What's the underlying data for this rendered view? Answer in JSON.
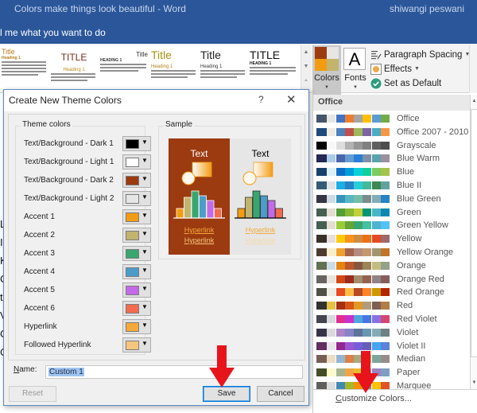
{
  "window": {
    "title": "Colors make things look beautiful  -  Word",
    "user": "shiwangi peswani",
    "tell_me": "l me what you want to do"
  },
  "ribbon": {
    "gallery_styles": [
      {
        "title": "Title",
        "heading": "Heading 1",
        "title_color": "#b57d1b",
        "heading_color": "#b57d1b"
      },
      {
        "title": "TITLE",
        "heading": "Heading 1",
        "title_color": "#7b2b1a",
        "heading_color": "#b58c1b"
      },
      {
        "title": "Title",
        "heading": "HEADING 1",
        "title_color": "#333333",
        "heading_color": "#333333"
      },
      {
        "title": "Title",
        "heading": "Heading 1",
        "title_color": "#a89218",
        "heading_color": "#b3801b"
      },
      {
        "title": "Title",
        "heading": "Heading 1",
        "title_color": "#222222",
        "heading_color": "#333333"
      },
      {
        "title": "TITLE",
        "heading": "HEADING 1",
        "title_color": "#111111",
        "heading_color": "#111111"
      }
    ],
    "colors_label": "Colors",
    "colors_swatch": [
      "#9c3a10",
      "#e6e6e6",
      "#f39c12",
      "#c2b46e"
    ],
    "fonts_label": "Fonts",
    "fonts_glyph": "A",
    "paragraph_spacing_label": "Paragraph Spacing",
    "effects_label": "Effects",
    "set_default_label": "Set as Default"
  },
  "dialog": {
    "title": "Create New Theme Colors",
    "help": "?",
    "close": "✕",
    "theme_colors_legend": "Theme colors",
    "sample_legend": "Sample",
    "theme_colors": [
      {
        "label": "Text/Background - Dark 1",
        "color": "#000000"
      },
      {
        "label": "Text/Background - Light 1",
        "color": "#ffffff"
      },
      {
        "label": "Text/Background - Dark 2",
        "color": "#9c3a10"
      },
      {
        "label": "Text/Background - Light 2",
        "color": "#e6e6e6"
      },
      {
        "label": "Accent 1",
        "color": "#f39c12"
      },
      {
        "label": "Accent 2",
        "color": "#c2b46e"
      },
      {
        "label": "Accent 3",
        "color": "#3aa66f"
      },
      {
        "label": "Accent 4",
        "color": "#4b9cc9"
      },
      {
        "label": "Accent 5",
        "color": "#c46ae8"
      },
      {
        "label": "Accent 6",
        "color": "#f26b4e"
      },
      {
        "label": "Hyperlink",
        "color": "#f5a93b"
      },
      {
        "label": "Followed Hyperlink",
        "color": "#f5c67e"
      }
    ],
    "sample": {
      "text_label": "Text",
      "hyperlink_label": "Hyperlink",
      "followed_hyperlink_label": "Hyperlink"
    },
    "name_label": "Name:",
    "name_value": "Custom 1",
    "reset_label": "Reset",
    "save_label": "Save",
    "cancel_label": "Cancel"
  },
  "panel": {
    "header": "Office",
    "themes": [
      {
        "name": "Office",
        "colors": [
          "#44546a",
          "#e7e6e6",
          "#4472c4",
          "#ed7d31",
          "#a5a5a5",
          "#ffc000",
          "#5b9bd5",
          "#70ad47"
        ]
      },
      {
        "name": "Office 2007 - 2010",
        "colors": [
          "#1f497d",
          "#eeece1",
          "#4f81bd",
          "#c0504d",
          "#9bbb59",
          "#8064a2",
          "#4bacc6",
          "#f79646"
        ]
      },
      {
        "name": "Grayscale",
        "colors": [
          "#000000",
          "#f8f8f8",
          "#dddddd",
          "#b2b2b2",
          "#969696",
          "#808080",
          "#5f5f5f",
          "#4d4d4d"
        ]
      },
      {
        "name": "Blue Warm",
        "colors": [
          "#242852",
          "#acccea",
          "#4a66ac",
          "#629dd1",
          "#297fd5",
          "#7f8fa9",
          "#5aa2ae",
          "#9d90a0"
        ]
      },
      {
        "name": "Blue",
        "colors": [
          "#17406d",
          "#dbeff9",
          "#0f6fc6",
          "#009dd9",
          "#0bd0d9",
          "#10cf9b",
          "#7cca62",
          "#a5c249"
        ]
      },
      {
        "name": "Blue II",
        "colors": [
          "#335b74",
          "#dfe3e5",
          "#1cade4",
          "#2683c6",
          "#27ced7",
          "#42ba97",
          "#3e8853",
          "#62a39f"
        ]
      },
      {
        "name": "Blue Green",
        "colors": [
          "#373545",
          "#cedbe6",
          "#3494ba",
          "#58b6c0",
          "#75bda7",
          "#7a8c8e",
          "#84acb6",
          "#2683c6"
        ]
      },
      {
        "name": "Green",
        "colors": [
          "#455f51",
          "#e3ded1",
          "#549e39",
          "#8ab833",
          "#c0cf3a",
          "#029676",
          "#4ab5c4",
          "#0989b1"
        ]
      },
      {
        "name": "Green Yellow",
        "colors": [
          "#455f51",
          "#e3ded1",
          "#99cb38",
          "#63a537",
          "#37a76f",
          "#44c1a3",
          "#4eb3cf",
          "#51c3f9"
        ]
      },
      {
        "name": "Yellow",
        "colors": [
          "#39302a",
          "#e5dedb",
          "#ffca08",
          "#f8931d",
          "#ce8d3e",
          "#ec7016",
          "#e64823",
          "#9c6a6a"
        ]
      },
      {
        "name": "Yellow Orange",
        "colors": [
          "#4e3b30",
          "#fbeec9",
          "#f0a22e",
          "#a5644e",
          "#b58b80",
          "#c3986d",
          "#a19574",
          "#c17529"
        ]
      },
      {
        "name": "Orange",
        "colors": [
          "#637052",
          "#ccddea",
          "#e48312",
          "#bd582c",
          "#865640",
          "#9b8357",
          "#c2bc80",
          "#94a088"
        ]
      },
      {
        "name": "Orange Red",
        "colors": [
          "#696464",
          "#e9e5dc",
          "#d34817",
          "#9b2d1f",
          "#a28e6a",
          "#956251",
          "#918485",
          "#855d5d"
        ]
      },
      {
        "name": "Red Orange",
        "colors": [
          "#505046",
          "#eeece1",
          "#e84c22",
          "#ffbd47",
          "#b64926",
          "#ff8427",
          "#cc9900",
          "#b22600"
        ]
      },
      {
        "name": "Red",
        "colors": [
          "#323232",
          "#e5c243",
          "#a5300f",
          "#d55816",
          "#e19825",
          "#b19c7d",
          "#7f5f52",
          "#b27d49"
        ]
      },
      {
        "name": "Red Violet",
        "colors": [
          "#454551",
          "#d8d9dc",
          "#e32d91",
          "#c830cc",
          "#4ea6dc",
          "#4775e7",
          "#8971e1",
          "#d54773"
        ]
      },
      {
        "name": "Violet",
        "colors": [
          "#373545",
          "#dcd8dc",
          "#ad84c6",
          "#8784c7",
          "#5d739a",
          "#6997af",
          "#84acb6",
          "#6f8183"
        ]
      },
      {
        "name": "Violet II",
        "colors": [
          "#632e62",
          "#eae5eb",
          "#92278f",
          "#9b57d3",
          "#755dd9",
          "#665eb8",
          "#45a5ed",
          "#5982db"
        ]
      },
      {
        "name": "Median",
        "colors": [
          "#775f55",
          "#ebddc3",
          "#94b6d2",
          "#dd8047",
          "#a5ab81",
          "#d8b25c",
          "#7ba79d",
          "#968c8c"
        ]
      },
      {
        "name": "Paper",
        "colors": [
          "#444d26",
          "#fefac9",
          "#a5b592",
          "#f3a447",
          "#e7bc29",
          "#d092a7",
          "#9c85c0",
          "#809ec2"
        ]
      },
      {
        "name": "Marquee",
        "colors": [
          "#5e5e5e",
          "#dddddd",
          "#418ab3",
          "#a6b727",
          "#f69200",
          "#838383",
          "#fec306",
          "#df5327"
        ]
      }
    ],
    "customize_label": "Customize Colors..."
  },
  "annotations": {
    "arrow_color": "#e8141b"
  },
  "document": {
    "margin_letters": [
      "L",
      "I",
      "K",
      "C",
      "t",
      "V",
      "C",
      "C"
    ]
  }
}
